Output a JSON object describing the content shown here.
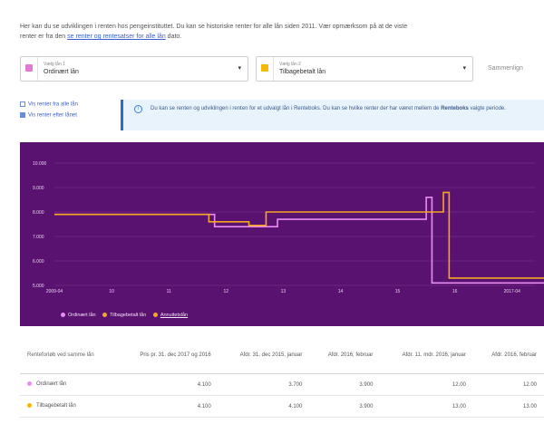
{
  "intro": {
    "text": "Her kan du se udviklingen i renten hos pengeinstituttet. Du kan se historiske renter for alle lån siden 2011. Vær opmærksom på at de viste renter er fra den",
    "link": "se renter og rentesatser for alle lån",
    "tail": "dato."
  },
  "selectors": [
    {
      "label": "Vælg lån 1",
      "value": "Ordinært lån",
      "color": "#e07ad6"
    },
    {
      "label": "Vælg lån 2",
      "value": "Tilbagebetalt lån",
      "color": "#f5b700"
    }
  ],
  "compare_button": "Sammenlign",
  "checkboxes": [
    {
      "label": "Vis renter fra alle lån",
      "checked": false
    },
    {
      "label": "Vis renter efter lånet",
      "checked": true
    }
  ],
  "info": {
    "icon": "i",
    "text_before": "Du kan se renten og udviklingen i renten for et udvalgt lån i Renteboks. Du kan se hvilke renter der har været mellem de",
    "bold": "Renteboks",
    "text_after": "valgte periode."
  },
  "chart_data": {
    "type": "line",
    "yticks": [
      "10.000",
      "9.000",
      "8.000",
      "7.000",
      "6.000",
      "5.000"
    ],
    "xticks": [
      "2009-04",
      "10",
      "11",
      "12",
      "13",
      "14",
      "15",
      "16",
      "2017-04"
    ],
    "ylim": [
      5000,
      10000
    ],
    "series": [
      {
        "name": "Ordinært lån",
        "color": "#e78cf0",
        "points": [
          [
            0,
            7900
          ],
          [
            2.8,
            7900
          ],
          [
            2.8,
            7400
          ],
          [
            3.9,
            7400
          ],
          [
            3.9,
            7700
          ],
          [
            6.5,
            7700
          ],
          [
            6.5,
            8600
          ],
          [
            6.6,
            8600
          ],
          [
            6.6,
            5100
          ],
          [
            12.4,
            5100
          ]
        ]
      },
      {
        "name": "Tilbagebetalt lån",
        "color": "#f5a623",
        "points": [
          [
            0,
            7900
          ],
          [
            2.7,
            7900
          ],
          [
            2.7,
            7600
          ],
          [
            3.4,
            7600
          ],
          [
            3.4,
            7450
          ],
          [
            3.7,
            7450
          ],
          [
            3.7,
            8000
          ],
          [
            6.8,
            8000
          ],
          [
            6.8,
            8800
          ],
          [
            6.9,
            8800
          ],
          [
            6.9,
            5300
          ],
          [
            12.4,
            5300
          ]
        ]
      }
    ],
    "marker": {
      "x": 10.9,
      "y": 5100
    }
  },
  "legend": [
    {
      "label": "Ordinært lån",
      "color": "#e78cf0"
    },
    {
      "label": "Tilbagebetalt lån",
      "color": "#f5a623"
    },
    {
      "label": "Annuitetslån",
      "color": "#f5a623"
    }
  ],
  "table": {
    "headers": [
      "Renteforløb ved samme lån",
      "Pris pr. 31. dec 2017 og 2016",
      "Afdr. 31. dec 2015, januar",
      "Afdr. 2016, februar",
      "Afdr. 11. mdr. 2016, januar",
      "Afdr. 2016, februar"
    ],
    "rows": [
      {
        "name": "Ordinært lån",
        "color": "#e78cf0",
        "values": [
          "4.100",
          "3.700",
          "3.900",
          "12.00",
          "12.00"
        ]
      },
      {
        "name": "Tilbagebetalt lån",
        "color": "#f5b700",
        "values": [
          "4.100",
          "4.100",
          "3.900",
          "13.00",
          "13.00"
        ]
      }
    ]
  }
}
